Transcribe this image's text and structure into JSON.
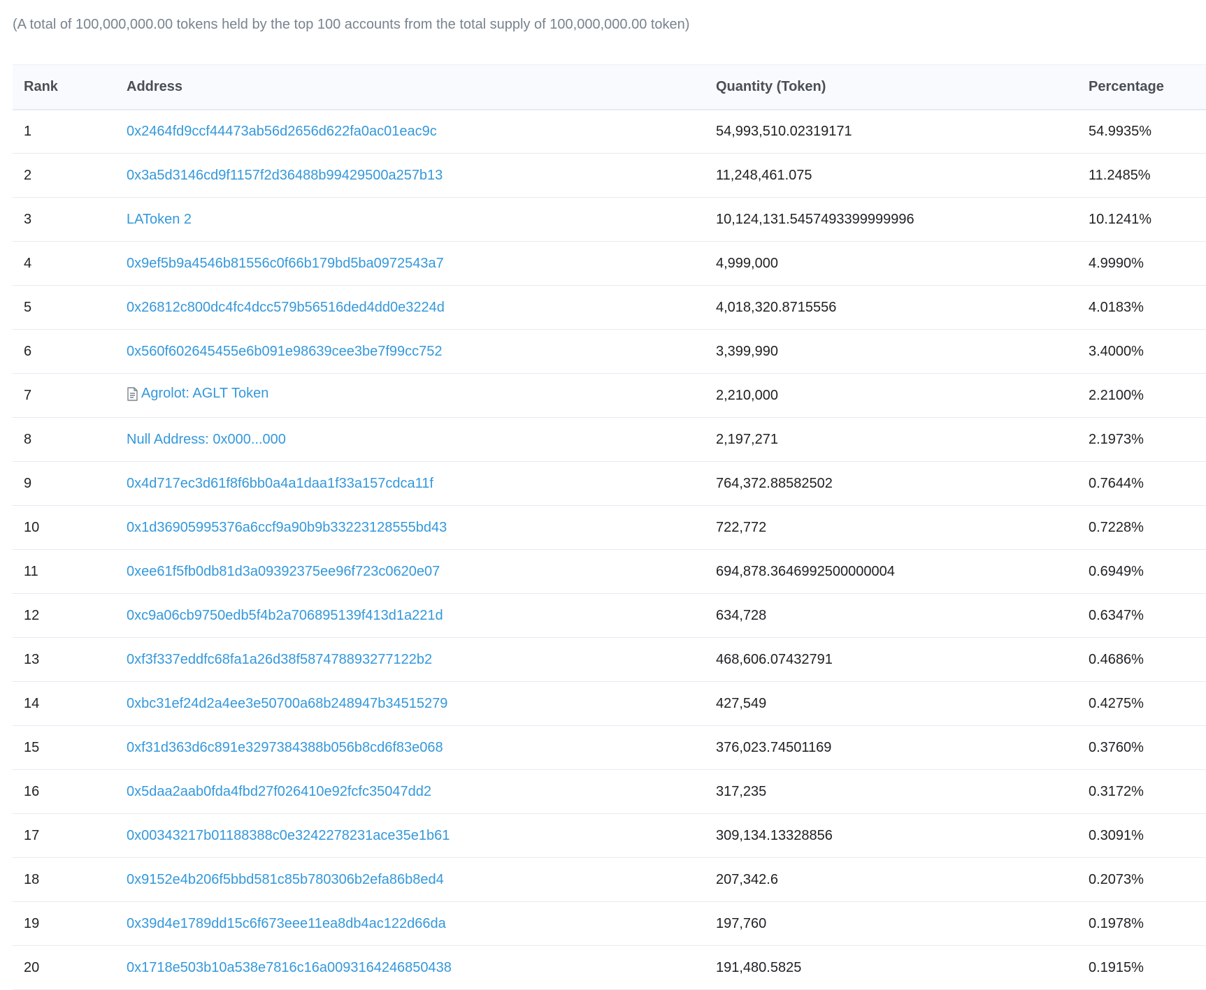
{
  "summary": "(A total of 100,000,000.00 tokens held by the top 100 accounts from the total supply of 100,000,000.00 token)",
  "table": {
    "headers": {
      "rank": "Rank",
      "address": "Address",
      "quantity": "Quantity (Token)",
      "percentage": "Percentage"
    },
    "link_color": "#3498db",
    "rows": [
      {
        "rank": "1",
        "address": "0x2464fd9ccf44473ab56d2656d622fa0ac01eac9c",
        "quantity": "54,993,510.02319171",
        "percentage": "54.9935%"
      },
      {
        "rank": "2",
        "address": "0x3a5d3146cd9f1157f2d36488b99429500a257b13",
        "quantity": "11,248,461.075",
        "percentage": "11.2485%"
      },
      {
        "rank": "3",
        "address": "LAToken 2",
        "quantity": "10,124,131.5457493399999996",
        "percentage": "10.1241%"
      },
      {
        "rank": "4",
        "address": "0x9ef5b9a4546b81556c0f66b179bd5ba0972543a7",
        "quantity": "4,999,000",
        "percentage": "4.9990%"
      },
      {
        "rank": "5",
        "address": "0x26812c800dc4fc4dcc579b56516ded4dd0e3224d",
        "quantity": "4,018,320.8715556",
        "percentage": "4.0183%"
      },
      {
        "rank": "6",
        "address": "0x560f602645455e6b091e98639cee3be7f99cc752",
        "quantity": "3,399,990",
        "percentage": "3.4000%"
      },
      {
        "rank": "7",
        "address": "Agrolot: AGLT Token",
        "quantity": "2,210,000",
        "percentage": "2.2100%",
        "icon": "contract-document-icon"
      },
      {
        "rank": "8",
        "address": "Null Address: 0x000...000",
        "quantity": "2,197,271",
        "percentage": "2.1973%"
      },
      {
        "rank": "9",
        "address": "0x4d717ec3d61f8f6bb0a4a1daa1f33a157cdca11f",
        "quantity": "764,372.88582502",
        "percentage": "0.7644%"
      },
      {
        "rank": "10",
        "address": "0x1d36905995376a6ccf9a90b9b33223128555bd43",
        "quantity": "722,772",
        "percentage": "0.7228%"
      },
      {
        "rank": "11",
        "address": "0xee61f5fb0db81d3a09392375ee96f723c0620e07",
        "quantity": "694,878.3646992500000004",
        "percentage": "0.6949%"
      },
      {
        "rank": "12",
        "address": "0xc9a06cb9750edb5f4b2a706895139f413d1a221d",
        "quantity": "634,728",
        "percentage": "0.6347%"
      },
      {
        "rank": "13",
        "address": "0xf3f337eddfc68fa1a26d38f587478893277122b2",
        "quantity": "468,606.07432791",
        "percentage": "0.4686%"
      },
      {
        "rank": "14",
        "address": "0xbc31ef24d2a4ee3e50700a68b248947b34515279",
        "quantity": "427,549",
        "percentage": "0.4275%"
      },
      {
        "rank": "15",
        "address": "0xf31d363d6c891e3297384388b056b8cd6f83e068",
        "quantity": "376,023.74501169",
        "percentage": "0.3760%"
      },
      {
        "rank": "16",
        "address": "0x5daa2aab0fda4fbd27f026410e92fcfc35047dd2",
        "quantity": "317,235",
        "percentage": "0.3172%"
      },
      {
        "rank": "17",
        "address": "0x00343217b01188388c0e3242278231ace35e1b61",
        "quantity": "309,134.13328856",
        "percentage": "0.3091%"
      },
      {
        "rank": "18",
        "address": "0x9152e4b206f5bbd581c85b780306b2efa86b8ed4",
        "quantity": "207,342.6",
        "percentage": "0.2073%"
      },
      {
        "rank": "19",
        "address": "0x39d4e1789dd15c6f673eee11ea8db4ac122d66da",
        "quantity": "197,760",
        "percentage": "0.1978%"
      },
      {
        "rank": "20",
        "address": "0x1718e503b10a538e7816c16a0093164246850438",
        "quantity": "191,480.5825",
        "percentage": "0.1915%"
      }
    ]
  }
}
